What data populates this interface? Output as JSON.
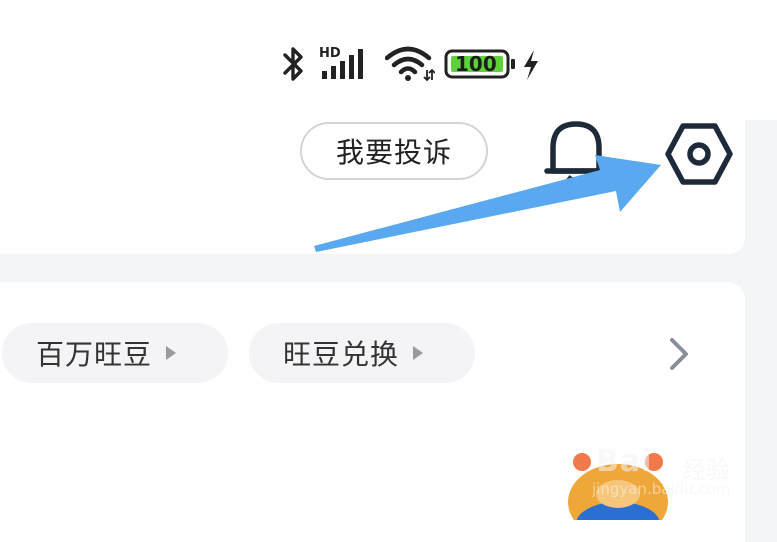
{
  "status_bar": {
    "signal_badge": "HD",
    "battery_level": "100",
    "icons": [
      "bluetooth-icon",
      "signal-icon",
      "wifi-icon",
      "battery-icon",
      "charging-icon"
    ]
  },
  "header": {
    "complain_button_label": "我要投诉",
    "icons": [
      "bell-icon",
      "settings-icon"
    ]
  },
  "menu": {
    "pills": [
      {
        "label": "百万旺豆"
      },
      {
        "label": "旺豆兑换"
      }
    ],
    "more_icon": "chevron-right-icon"
  },
  "watermark": {
    "logo": "Bai",
    "logo_suffix": "经验",
    "url": "jingyan.baidu.com"
  },
  "colors": {
    "accent_arrow": "#5aa9f0",
    "icon_dark": "#1e2a3a",
    "battery_green": "#5ed13c"
  }
}
